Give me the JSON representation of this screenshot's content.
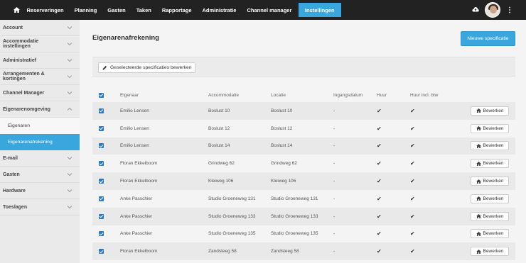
{
  "topnav": {
    "items": [
      {
        "label": "Reserveringen"
      },
      {
        "label": "Planning"
      },
      {
        "label": "Gasten"
      },
      {
        "label": "Taken"
      },
      {
        "label": "Rapportage"
      },
      {
        "label": "Administratie"
      },
      {
        "label": "Channel manager"
      },
      {
        "label": "Instellingen",
        "active": true
      }
    ],
    "icons": {
      "home": "home-icon",
      "upload": "cloud-upload-icon",
      "menu": "vertical-dots-icon"
    },
    "accent": "#3aa6de"
  },
  "sidebar": {
    "items": [
      {
        "label": "Account"
      },
      {
        "label": "Accommodatie instellingen"
      },
      {
        "label": "Administratief"
      },
      {
        "label": "Arrangementen & kortingen"
      },
      {
        "label": "Channel Manager"
      },
      {
        "label": "Eigenarenomgeving",
        "expanded": true
      },
      {
        "label": "E-mail"
      },
      {
        "label": "Gasten"
      },
      {
        "label": "Hardware"
      },
      {
        "label": "Toeslagen"
      }
    ],
    "subitems": [
      {
        "label": "Eigenaren"
      },
      {
        "label": "Eigenarenafrekening",
        "active": true
      }
    ]
  },
  "main": {
    "title": "Eigenarenafrekening",
    "new_button": "Nieuwe specificatie",
    "edit_selected_button": "Geselecteerde specificaties bewerken",
    "table": {
      "headers": [
        "Eigenaar",
        "Accommodatie",
        "Locatie",
        "Ingangsdatum",
        "Huur",
        "Huur incl. btw"
      ],
      "rows": [
        {
          "owner": "Emilio Lensen",
          "accommodation": "Boslust 10",
          "location": "Boslust 10",
          "date": "-",
          "rent": true,
          "rent_vat": true
        },
        {
          "owner": "Emilio Lensen",
          "accommodation": "Boslust 12",
          "location": "Boslust 12",
          "date": "-",
          "rent": true,
          "rent_vat": true
        },
        {
          "owner": "Emilio Lensen",
          "accommodation": "Boslust 14",
          "location": "Boslust 14",
          "date": "-",
          "rent": true,
          "rent_vat": true
        },
        {
          "owner": "Floran Ekkelboom",
          "accommodation": "Grindweg 62",
          "location": "Grindweg 62",
          "date": "-",
          "rent": true,
          "rent_vat": true
        },
        {
          "owner": "Floran Ekkelboom",
          "accommodation": "Kleiweg 106",
          "location": "Kleiweg 106",
          "date": "-",
          "rent": true,
          "rent_vat": true
        },
        {
          "owner": "Anke Passchier",
          "accommodation": "Studio Groeneweg 131",
          "location": "Studio Groeneweg 131",
          "date": "-",
          "rent": true,
          "rent_vat": true
        },
        {
          "owner": "Anke Passchier",
          "accommodation": "Studio Groeneweg 133",
          "location": "Studio Groeneweg 133",
          "date": "-",
          "rent": true,
          "rent_vat": true
        },
        {
          "owner": "Anke Passchier",
          "accommodation": "Studio Groeneweg 135",
          "location": "Studio Groeneweg 135",
          "date": "-",
          "rent": true,
          "rent_vat": true
        },
        {
          "owner": "Floran Ekkelboom",
          "accommodation": "Zandsteeg 58",
          "location": "Zandsteeg 58",
          "date": "-",
          "rent": true,
          "rent_vat": true
        }
      ],
      "row_button": "Bewerken",
      "check_mark": "✔"
    }
  }
}
